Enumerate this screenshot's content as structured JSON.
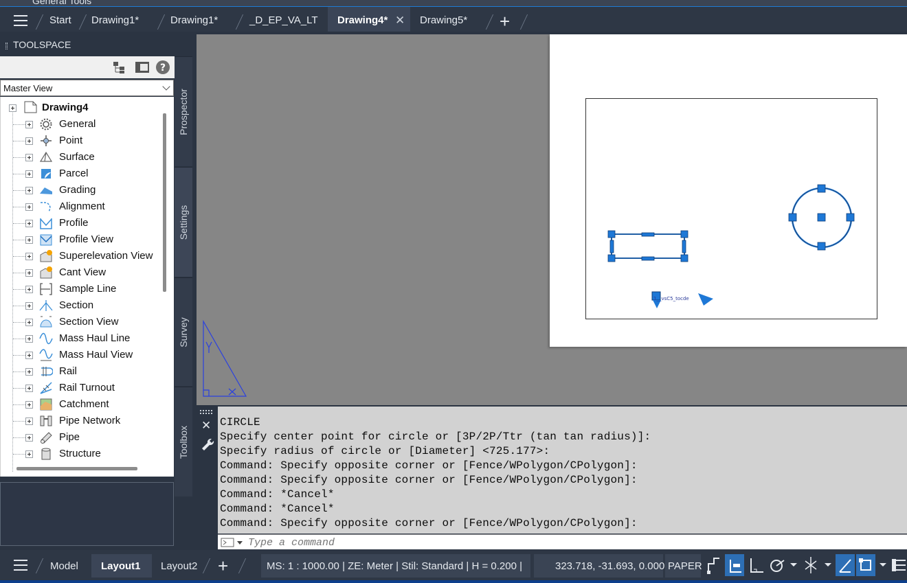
{
  "ribbon": {
    "panel_label": "General Tools"
  },
  "tabs": [
    {
      "label": "Start",
      "active": false
    },
    {
      "label": "Drawing1*",
      "active": false
    },
    {
      "label": "Drawing1*",
      "active": false
    },
    {
      "label": "_D_EP_VA_LT",
      "active": false
    },
    {
      "label": "Drawing4*",
      "active": true
    },
    {
      "label": "Drawing5*",
      "active": false
    }
  ],
  "toolspace": {
    "title": "TOOLSPACE",
    "view_select": "Master View",
    "root": "Drawing4",
    "items": [
      {
        "label": "General",
        "icon": "gear-icon"
      },
      {
        "label": "Point",
        "icon": "point-icon"
      },
      {
        "label": "Surface",
        "icon": "surface-icon"
      },
      {
        "label": "Parcel",
        "icon": "parcel-icon"
      },
      {
        "label": "Grading",
        "icon": "grading-icon"
      },
      {
        "label": "Alignment",
        "icon": "alignment-icon"
      },
      {
        "label": "Profile",
        "icon": "profile-icon"
      },
      {
        "label": "Profile View",
        "icon": "profile-view-icon"
      },
      {
        "label": "Superelevation View",
        "icon": "superelevation-view-icon"
      },
      {
        "label": "Cant View",
        "icon": "cant-view-icon"
      },
      {
        "label": "Sample Line",
        "icon": "sample-line-icon"
      },
      {
        "label": "Section",
        "icon": "section-icon"
      },
      {
        "label": "Section View",
        "icon": "section-view-icon"
      },
      {
        "label": "Mass Haul Line",
        "icon": "mass-haul-line-icon"
      },
      {
        "label": "Mass Haul View",
        "icon": "mass-haul-view-icon"
      },
      {
        "label": "Rail",
        "icon": "rail-icon"
      },
      {
        "label": "Rail Turnout",
        "icon": "rail-turnout-icon"
      },
      {
        "label": "Catchment",
        "icon": "catchment-icon"
      },
      {
        "label": "Pipe Network",
        "icon": "pipe-network-icon"
      },
      {
        "label": "Pipe",
        "icon": "pipe-icon"
      },
      {
        "label": "Structure",
        "icon": "structure-icon"
      }
    ],
    "side_tabs": [
      "Prospector",
      "Settings",
      "Survey",
      "Toolbox"
    ],
    "active_side_tab": "Settings"
  },
  "drawing": {
    "label_text": "1__vsC5_tocde"
  },
  "command": {
    "history": [
      "CIRCLE",
      "Specify center point for circle or [3P/2P/Ttr (tan tan radius)]:",
      "Specify radius of circle or [Diameter] <725.177>:",
      "Command: Specify opposite corner or [Fence/WPolygon/CPolygon]:",
      "Command: Specify opposite corner or [Fence/WPolygon/CPolygon]:",
      "Command: *Cancel*",
      "Command: *Cancel*",
      "Command: Specify opposite corner or [Fence/WPolygon/CPolygon]:"
    ],
    "placeholder": "Type a command"
  },
  "status": {
    "layout_tabs": [
      {
        "label": "Model",
        "active": false
      },
      {
        "label": "Layout1",
        "active": true
      },
      {
        "label": "Layout2",
        "active": false
      }
    ],
    "info": "MS: 1 : 1000.00  | ZE: Meter  | Stil: Standard  | H = 0.200  |",
    "coords": "323.718, -31.693, 0.000",
    "space": "PAPER"
  },
  "colors": {
    "grip_blue": "#1e78d6",
    "accent": "#2d6fb5",
    "canvas_gray": "#868686"
  }
}
